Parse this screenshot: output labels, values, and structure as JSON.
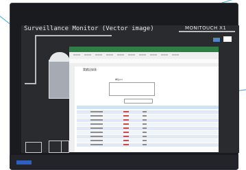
{
  "hmi": {
    "title": "Surveillance Monitor (Vector image)",
    "logo": "MONITOUCH X1"
  },
  "spreadsheet": {
    "sheet_title": "実績記録表",
    "unit_label": "単位/ml"
  },
  "colors": {
    "callout": "#34aadf",
    "bezel": "#1a1b1f",
    "excel_green": "#2f7e46",
    "row_band": "#dfeaf6"
  }
}
